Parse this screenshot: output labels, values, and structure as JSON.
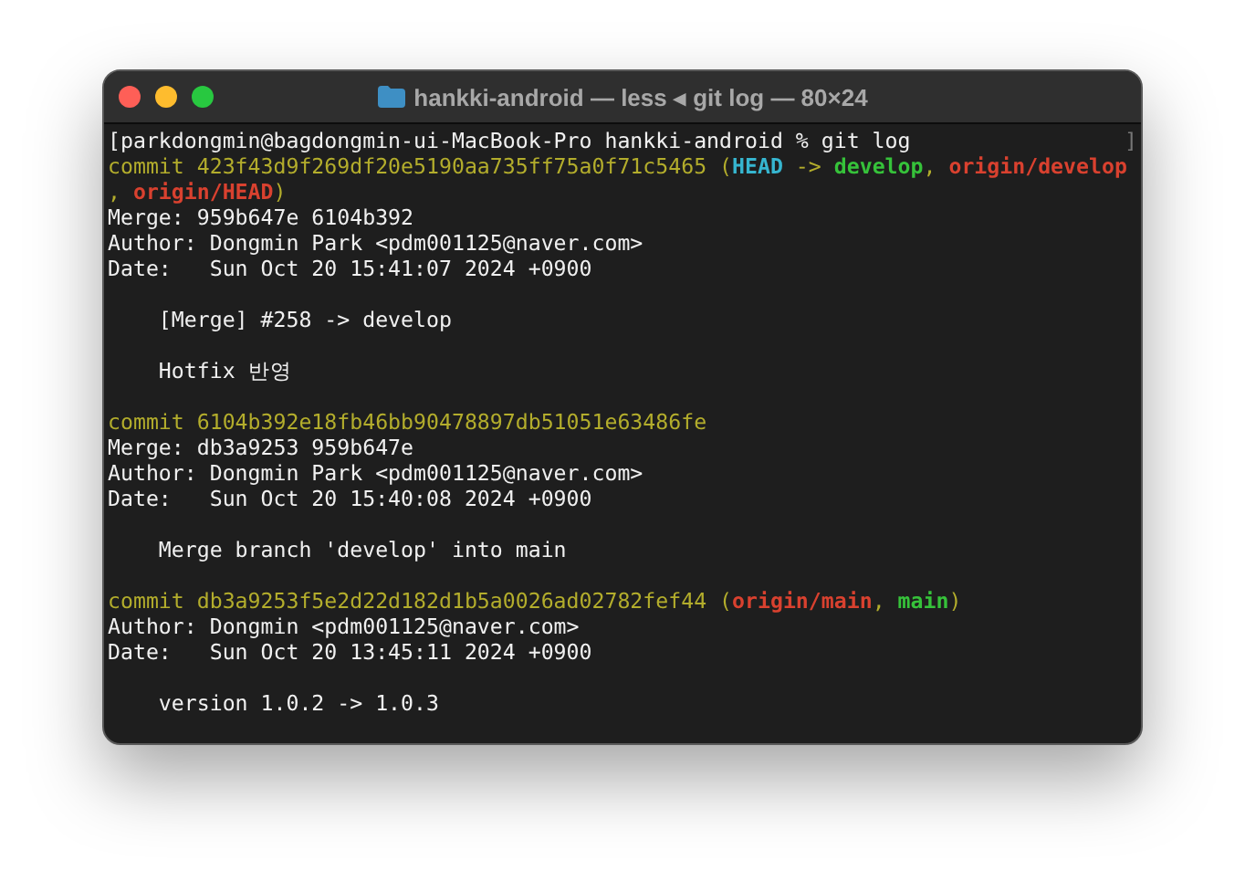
{
  "window": {
    "title": "hankki-android — less ◂ git log — 80×24"
  },
  "lines": [
    {
      "kind": "prompt",
      "segments": [
        {
          "kind": "plain",
          "text": "[parkdongmin@bagdongmin-ui-MacBook-Pro hankki-android % git log"
        }
      ],
      "edge_mark": "]"
    },
    {
      "kind": "text",
      "segments": [
        {
          "kind": "hash",
          "text": "commit 423f43d9f269df20e5190aa735ff75a0f71c5465 ("
        },
        {
          "kind": "head",
          "text": "HEAD"
        },
        {
          "kind": "hash",
          "text": " -> "
        },
        {
          "kind": "local",
          "text": "develop"
        },
        {
          "kind": "hash",
          "text": ", "
        },
        {
          "kind": "remote",
          "text": "origin/develop"
        }
      ]
    },
    {
      "kind": "text",
      "segments": [
        {
          "kind": "hash",
          "text": ", "
        },
        {
          "kind": "remote",
          "text": "origin/HEAD"
        },
        {
          "kind": "hash",
          "text": ")"
        }
      ]
    },
    {
      "kind": "text",
      "segments": [
        {
          "kind": "plain",
          "text": "Merge: 959b647e 6104b392"
        }
      ]
    },
    {
      "kind": "text",
      "segments": [
        {
          "kind": "plain",
          "text": "Author: Dongmin Park <pdm001125@naver.com>"
        }
      ]
    },
    {
      "kind": "text",
      "segments": [
        {
          "kind": "plain",
          "text": "Date:   Sun Oct 20 15:41:07 2024 +0900"
        }
      ]
    },
    {
      "kind": "blank"
    },
    {
      "kind": "text",
      "segments": [
        {
          "kind": "plain",
          "text": "    [Merge] #258 -> develop"
        }
      ]
    },
    {
      "kind": "blank"
    },
    {
      "kind": "text",
      "segments": [
        {
          "kind": "plain",
          "text": "    Hotfix 반영"
        }
      ]
    },
    {
      "kind": "blank"
    },
    {
      "kind": "text",
      "segments": [
        {
          "kind": "hash",
          "text": "commit 6104b392e18fb46bb90478897db51051e63486fe"
        }
      ]
    },
    {
      "kind": "text",
      "segments": [
        {
          "kind": "plain",
          "text": "Merge: db3a9253 959b647e"
        }
      ]
    },
    {
      "kind": "text",
      "segments": [
        {
          "kind": "plain",
          "text": "Author: Dongmin Park <pdm001125@naver.com>"
        }
      ]
    },
    {
      "kind": "text",
      "segments": [
        {
          "kind": "plain",
          "text": "Date:   Sun Oct 20 15:40:08 2024 +0900"
        }
      ]
    },
    {
      "kind": "blank"
    },
    {
      "kind": "text",
      "segments": [
        {
          "kind": "plain",
          "text": "    Merge branch 'develop' into main"
        }
      ]
    },
    {
      "kind": "blank"
    },
    {
      "kind": "text",
      "segments": [
        {
          "kind": "hash",
          "text": "commit db3a9253f5e2d22d182d1b5a0026ad02782fef44 ("
        },
        {
          "kind": "remote",
          "text": "origin/main"
        },
        {
          "kind": "hash",
          "text": ", "
        },
        {
          "kind": "local",
          "text": "main"
        },
        {
          "kind": "hash",
          "text": ")"
        }
      ]
    },
    {
      "kind": "text",
      "segments": [
        {
          "kind": "plain",
          "text": "Author: Dongmin <pdm001125@naver.com>"
        }
      ]
    },
    {
      "kind": "text",
      "segments": [
        {
          "kind": "plain",
          "text": "Date:   Sun Oct 20 13:45:11 2024 +0900"
        }
      ]
    },
    {
      "kind": "blank"
    },
    {
      "kind": "text",
      "segments": [
        {
          "kind": "plain",
          "text": "    version 1.0.2 -> 1.0.3"
        }
      ]
    }
  ]
}
